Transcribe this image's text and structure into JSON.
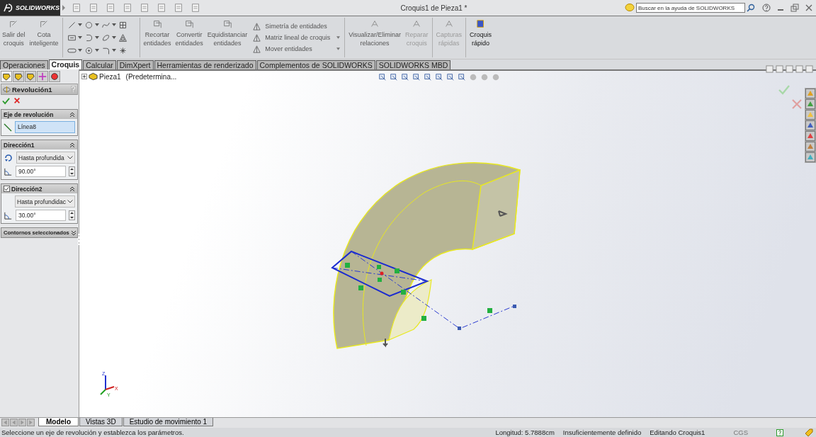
{
  "app": {
    "logo": "SOLIDWORKS",
    "title": "Croquis1 de Pieza1 *",
    "search": {
      "placeholder": "Buscar en la ayuda de SOLIDWORKS"
    }
  },
  "ribbon": {
    "left_buttons": [
      {
        "label": "Salir del\ncroquis",
        "disabled": false
      },
      {
        "label": "Cota\ninteligente",
        "disabled": false
      }
    ],
    "edit_buttons": [
      {
        "label": "Recortar\nentidades",
        "disabled": false
      },
      {
        "label": "Convertir\nentidades",
        "disabled": false
      },
      {
        "label": "Equidistanciar\nentidades",
        "disabled": false
      }
    ],
    "list_items": [
      {
        "label": "Simetría de entidades",
        "dropdown": false
      },
      {
        "label": "Matriz lineal de croquis",
        "dropdown": true
      },
      {
        "label": "Mover entidades",
        "dropdown": true
      }
    ],
    "right_buttons": [
      {
        "label": "Visualizar/Eliminar\nrelaciones",
        "disabled": false
      },
      {
        "label": "Reparar\ncroquis",
        "disabled": true
      },
      {
        "label": "Capturas\nrápidas",
        "disabled": true
      },
      {
        "label": "Croquis\nrápido",
        "disabled": false
      }
    ]
  },
  "tabs": [
    {
      "label": "Operaciones",
      "selected": false
    },
    {
      "label": "Croquis",
      "selected": true
    },
    {
      "label": "Calcular",
      "selected": false
    },
    {
      "label": "DimXpert",
      "selected": false
    },
    {
      "label": "Herramientas de renderizado",
      "selected": false
    },
    {
      "label": "Complementos de SOLIDWORKS",
      "selected": false
    },
    {
      "label": "SOLIDWORKS MBD",
      "selected": false
    }
  ],
  "property_manager": {
    "title": "Revolución1",
    "sections": [
      {
        "kind": "axis",
        "title": "Eje de revolución",
        "expanded": true,
        "value": "Línea8"
      },
      {
        "kind": "direction",
        "title": "Dirección1",
        "expanded": true,
        "type": "Hasta profundida",
        "angle": "90.00°"
      },
      {
        "kind": "direction",
        "title": "Dirección2",
        "expanded": true,
        "checked": true,
        "type": "Hasta profundidac",
        "angle": "30.00°"
      },
      {
        "kind": "contours",
        "title": "Contornos seleccionados",
        "expanded": false
      }
    ]
  },
  "feature_tree": {
    "root": "Pieza1",
    "config": "(Predetermina..."
  },
  "triad": {
    "z": "Z",
    "y": "Y",
    "x": "X"
  },
  "bottom_tabs": [
    {
      "label": "Modelo",
      "selected": true
    },
    {
      "label": "Vistas 3D",
      "selected": false
    },
    {
      "label": "Estudio de movimiento 1",
      "selected": false
    }
  ],
  "status_bar": {
    "message": "Seleccione un eje de revolución y establezca los parámetros.",
    "length": "Longitud: 5.7888cm",
    "state": "Insuficientemente definido",
    "editing": "Editando Croquis1",
    "units": "CGS"
  }
}
